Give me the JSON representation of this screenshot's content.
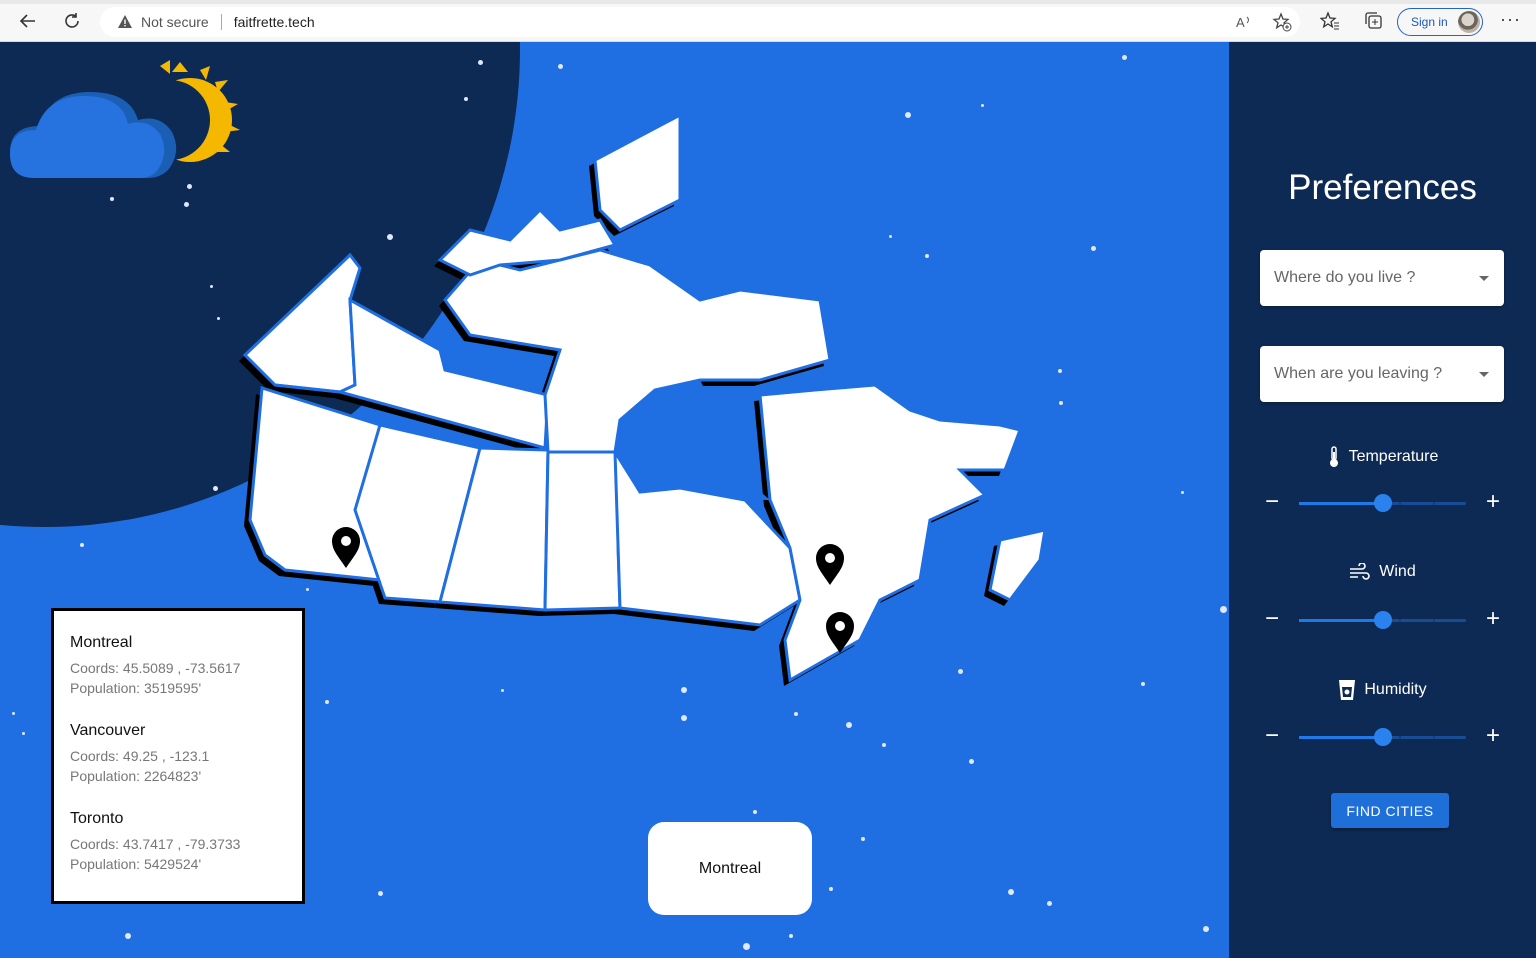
{
  "browser": {
    "security_label": "Not secure",
    "url": "faitfrette.tech",
    "signin_label": "Sign in",
    "more_label": "···"
  },
  "map": {
    "pins": [
      "Vancouver",
      "Montreal",
      "Toronto"
    ]
  },
  "cities": [
    {
      "name": "Montreal",
      "coords": "Coords: 45.5089 , -73.5617",
      "population": "Population: 3519595'"
    },
    {
      "name": "Vancouver",
      "coords": "Coords: 49.25 , -123.1",
      "population": "Population: 2264823'"
    },
    {
      "name": "Toronto",
      "coords": "Coords: 43.7417 , -79.3733",
      "population": "Population: 5429524'"
    }
  ],
  "selected_city": "Montreal",
  "preferences": {
    "title": "Preferences",
    "live_placeholder": "Where do you live ?",
    "leaving_placeholder": "When are you leaving ?",
    "temperature": {
      "label": "Temperature",
      "value": 0.5,
      "icon": "thermometer-icon"
    },
    "wind": {
      "label": "Wind",
      "value": 0.5,
      "icon": "wind-icon"
    },
    "humidity": {
      "label": "Humidity",
      "value": 0.5,
      "icon": "cup-icon"
    },
    "minus": "−",
    "plus": "+",
    "find_button": "FIND CITIES"
  },
  "colors": {
    "ocean": "#1f6fe3",
    "night": "#0d2a55",
    "accent": "#1f6fd9"
  }
}
